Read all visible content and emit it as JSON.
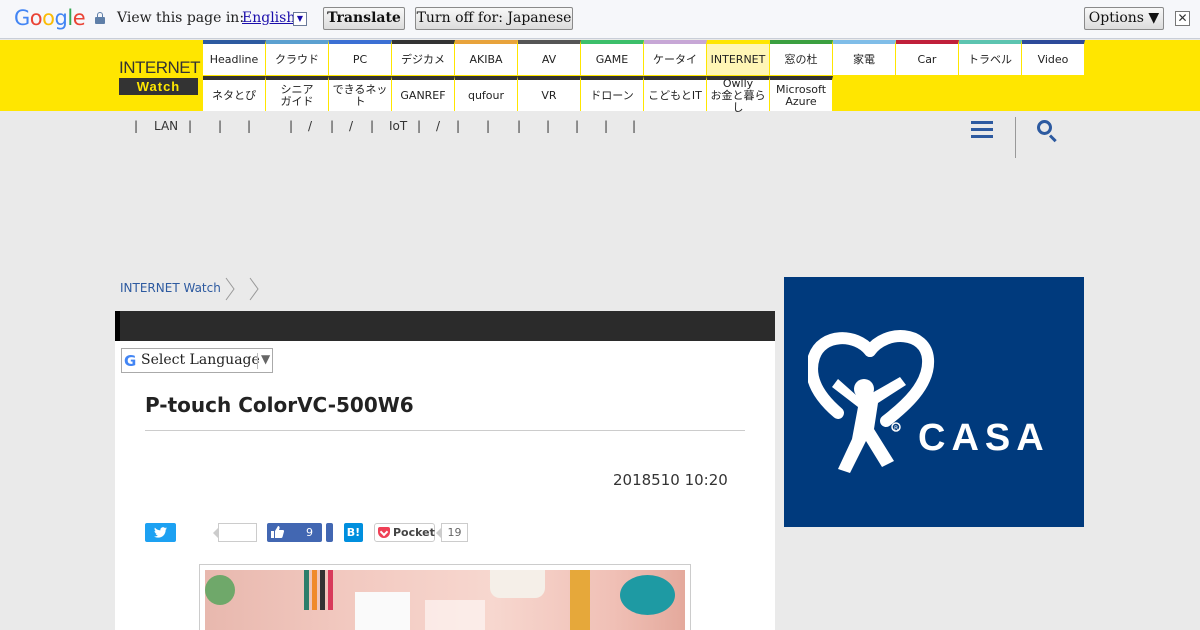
{
  "translate_bar": {
    "logo": [
      "G",
      "o",
      "o",
      "g",
      "l",
      "e"
    ],
    "prompt": "View this page in:",
    "language": "English",
    "translate_label": "Translate",
    "turn_off_label": "Turn off for: Japanese",
    "options_label": "Options ▼",
    "close_glyph": "✕"
  },
  "header": {
    "logo_top": "INTERNET",
    "logo_bottom": "Watch",
    "nav_row1": [
      {
        "label": "Headline",
        "color": "#2d5aa0"
      },
      {
        "label": "クラウド",
        "color": "#5ba0d0"
      },
      {
        "label": "PC",
        "color": "#3b6fd4"
      },
      {
        "label": "デジカメ",
        "color": "#333333"
      },
      {
        "label": "AKIBA",
        "color": "#e8a33b"
      },
      {
        "label": "AV",
        "color": "#555555"
      },
      {
        "label": "GAME",
        "color": "#3cbf6a"
      },
      {
        "label": "ケータイ",
        "color": "#c7a7d6"
      },
      {
        "label": "INTERNET",
        "color": "#ffe600"
      },
      {
        "label": "窓の杜",
        "color": "#3ba040"
      },
      {
        "label": "家電",
        "color": "#7fbde8"
      },
      {
        "label": "Car",
        "color": "#c0203a"
      },
      {
        "label": "トラベル",
        "color": "#5cc4b0"
      },
      {
        "label": "Video",
        "color": "#2d4a9a"
      }
    ],
    "nav_row2": [
      {
        "label": "ネタとぴ"
      },
      {
        "label": "シニア\nガイド"
      },
      {
        "label": "できるネット"
      },
      {
        "label": "GANREF"
      },
      {
        "label": "qufour"
      },
      {
        "label": "VR"
      },
      {
        "label": "ドローン"
      },
      {
        "label": "こどもとIT"
      },
      {
        "label": "Owlly\nお金と暮らし"
      },
      {
        "label": "Microsoft\nAzure"
      }
    ]
  },
  "subnav": {
    "items": [
      "|",
      "LAN",
      "|",
      "|",
      "|",
      "|",
      "/",
      "|",
      "/",
      "|",
      "IoT",
      "|",
      "/",
      "|",
      "|",
      "|",
      "|",
      "|",
      "|",
      "|"
    ]
  },
  "breadcrumb": {
    "home": "INTERNET Watch"
  },
  "article": {
    "select_language": "Select Language",
    "select_g": "G",
    "select_arrow": "▼",
    "title": "P-touch ColorVC-500W6",
    "date": "2018510 10:20",
    "share": {
      "fb_count": "9",
      "hatena": "B!",
      "pocket_label": "Pocket",
      "pocket_count": "19"
    }
  },
  "ad": {
    "brand": "CASA",
    "color": "#003a7d"
  }
}
